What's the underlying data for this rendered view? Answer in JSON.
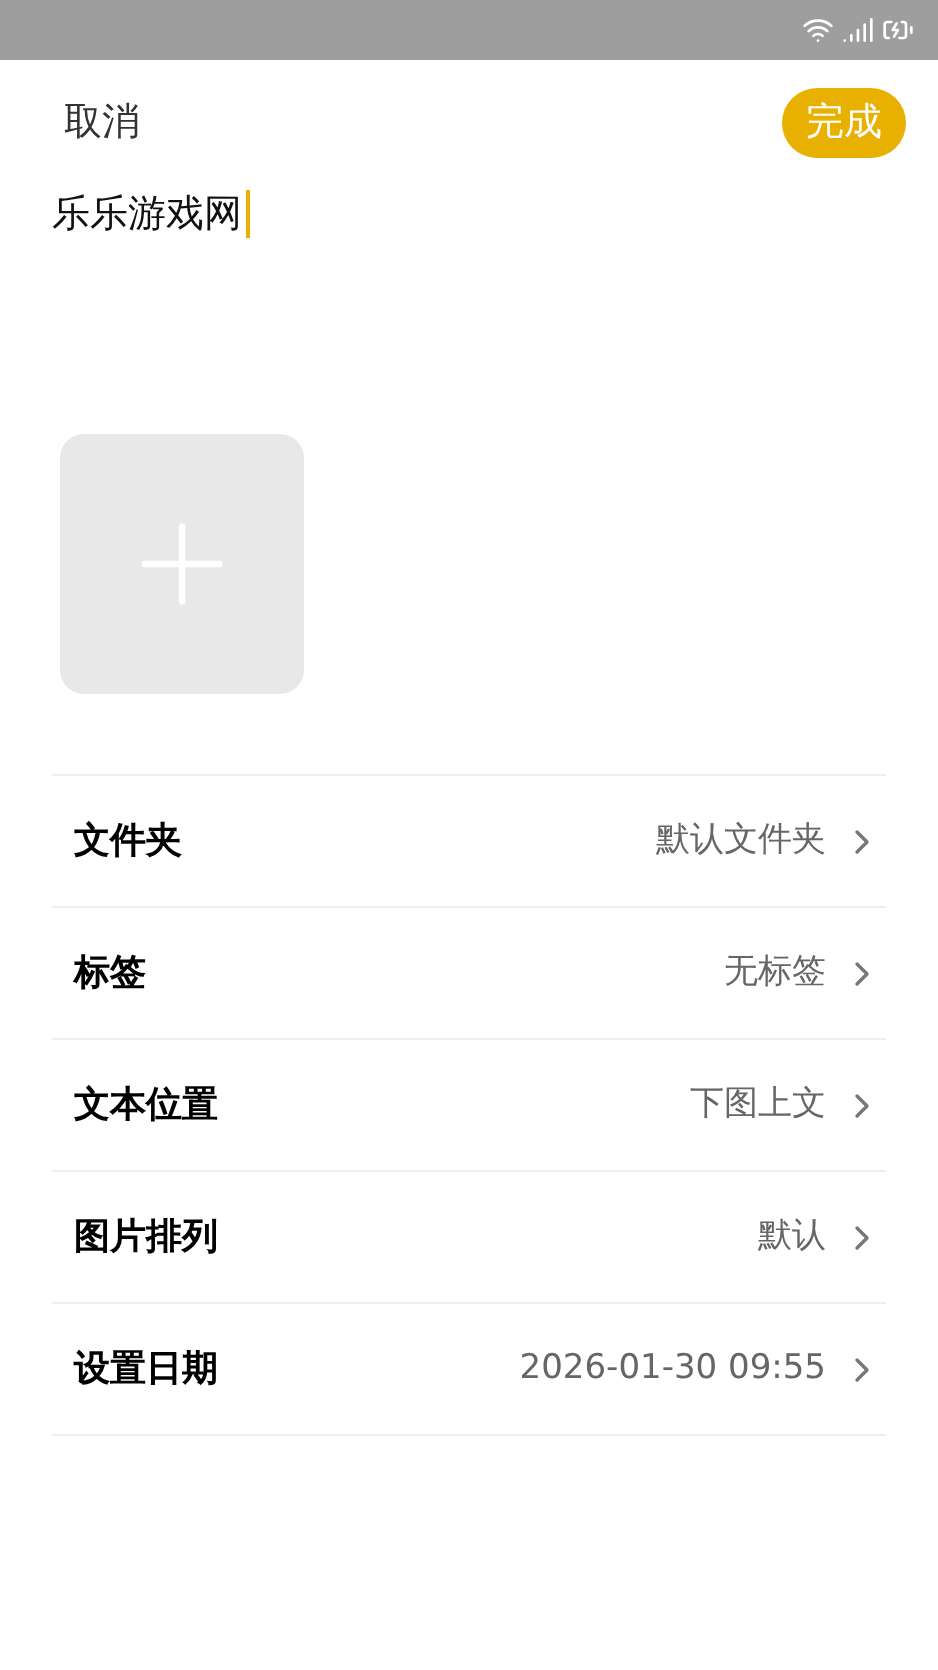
{
  "header": {
    "cancel": "取消",
    "done": "完成"
  },
  "note": {
    "value": "乐乐游戏网"
  },
  "settings": [
    {
      "label": "文件夹",
      "value": "默认文件夹"
    },
    {
      "label": "标签",
      "value": "无标签"
    },
    {
      "label": "文本位置",
      "value": "下图上文"
    },
    {
      "label": "图片排列",
      "value": "默认"
    },
    {
      "label": "设置日期",
      "value": "2026-01-30 09:55"
    }
  ]
}
